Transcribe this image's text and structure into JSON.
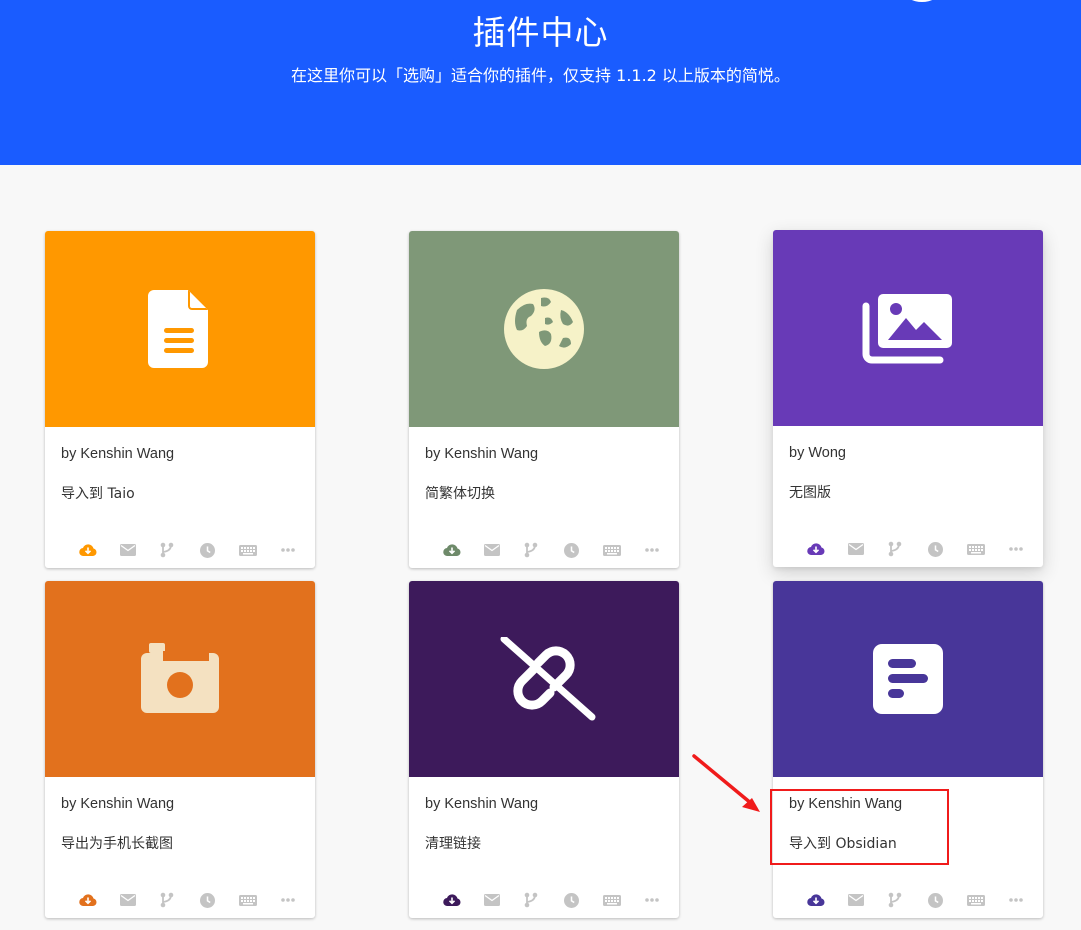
{
  "header": {
    "title": "插件中心",
    "subtitle": "在这里你可以「选购」适合你的插件，仅支持 1.1.2 以上版本的简悦。"
  },
  "cards": [
    {
      "author": "by Kenshin Wang",
      "description": "导入到 Taio",
      "media_color": "#ff9800",
      "icon_color": "#ffffff",
      "icon": "document-icon",
      "accent": "#ff9800"
    },
    {
      "author": "by Kenshin Wang",
      "description": "简繁体切换",
      "media_color": "#7f9878",
      "icon_color": "#f6f2c8",
      "icon": "globe-icon",
      "accent": "#6e8a6a"
    },
    {
      "author": "by Wong",
      "description": "无图版",
      "media_color": "#683ab7",
      "icon_color": "#ffffff",
      "icon": "image-gallery-icon",
      "accent": "#683ab7"
    },
    {
      "author": "by Kenshin Wang",
      "description": "导出为手机长截图",
      "media_color": "#e2711d",
      "icon_color": "#f4e1c1",
      "icon": "camera-icon",
      "accent": "#e2711d"
    },
    {
      "author": "by Kenshin Wang",
      "description": "清理链接",
      "media_color": "#3d1a5b",
      "icon_color": "#ffffff",
      "icon": "link-off-icon",
      "accent": "#3d1a5b"
    },
    {
      "author": "by Kenshin Wang",
      "description": "导入到 Obsidian",
      "media_color": "#483699",
      "icon_color": "#ffffff",
      "icon": "note-icon",
      "accent": "#483699"
    }
  ],
  "card_actions": [
    "download-cloud-icon",
    "mail-icon",
    "git-branch-icon",
    "clock-icon",
    "keyboard-icon",
    "more-icon"
  ],
  "colors": {
    "header_bg": "#1a5cff",
    "page_bg": "#f8f8f8",
    "action_gray": "#c4c4c4",
    "annotation_red": "#f01b1b"
  }
}
